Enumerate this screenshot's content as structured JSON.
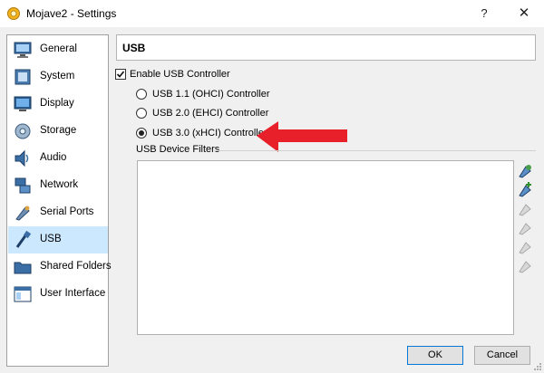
{
  "window": {
    "title": "Mojave2 - Settings",
    "help_glyph": "?",
    "close_glyph": "✕"
  },
  "sidebar": {
    "items": [
      {
        "label": "General",
        "icon": "monitor-icon",
        "selected": false
      },
      {
        "label": "System",
        "icon": "chip-icon",
        "selected": false
      },
      {
        "label": "Display",
        "icon": "display-icon",
        "selected": false
      },
      {
        "label": "Storage",
        "icon": "disk-icon",
        "selected": false
      },
      {
        "label": "Audio",
        "icon": "speaker-icon",
        "selected": false
      },
      {
        "label": "Network",
        "icon": "network-icon",
        "selected": false
      },
      {
        "label": "Serial Ports",
        "icon": "serial-port-icon",
        "selected": false
      },
      {
        "label": "USB",
        "icon": "usb-icon",
        "selected": true
      },
      {
        "label": "Shared Folders",
        "icon": "folder-icon",
        "selected": false
      },
      {
        "label": "User Interface",
        "icon": "window-icon",
        "selected": false
      }
    ]
  },
  "main": {
    "section_title": "USB",
    "enable_usb": {
      "label": "Enable USB Controller",
      "checked": true
    },
    "controllers": [
      {
        "label": "USB 1.1 (OHCI) Controller",
        "selected": false
      },
      {
        "label": "USB 2.0 (EHCI) Controller",
        "selected": false
      },
      {
        "label": "USB 3.0 (xHCI) Controller",
        "selected": true
      }
    ],
    "filters_label": "USB Device Filters",
    "filter_tools": [
      {
        "name": "add-empty-filter-icon",
        "enabled": true
      },
      {
        "name": "add-filter-from-device-icon",
        "enabled": true
      },
      {
        "name": "edit-filter-icon",
        "enabled": false
      },
      {
        "name": "remove-filter-icon",
        "enabled": false
      },
      {
        "name": "move-filter-up-icon",
        "enabled": false
      },
      {
        "name": "move-filter-down-icon",
        "enabled": false
      }
    ]
  },
  "buttons": {
    "ok": "OK",
    "cancel": "Cancel"
  },
  "colors": {
    "selection": "#cce8ff",
    "arrow": "#e8202a",
    "accent": "#0078d7"
  }
}
